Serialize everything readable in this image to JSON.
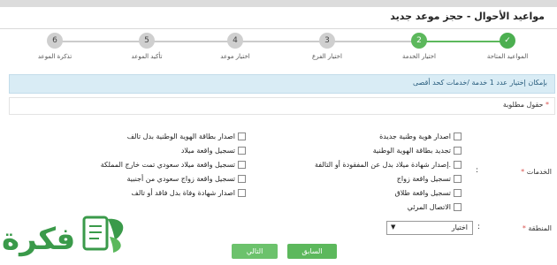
{
  "header": {
    "title": "مواعيد الأحوال - حجز موعد جديد"
  },
  "steps": [
    {
      "number": "✓",
      "label": "المواعيد المتاحة",
      "state": "done"
    },
    {
      "number": "2",
      "label": "اختيار الخدمة",
      "state": "active"
    },
    {
      "number": "3",
      "label": "اختيار الفرع",
      "state": "pending"
    },
    {
      "number": "4",
      "label": "اختيار موعد",
      "state": "pending"
    },
    {
      "number": "5",
      "label": "تأكيد الموعد",
      "state": "pending"
    },
    {
      "number": "6",
      "label": "تذكرة الموعد",
      "state": "pending"
    }
  ],
  "notice": "بإمكان إختيار عدد 1 خدمة /خدمات كحد أقصى",
  "required_note": "حقول مطلوبة",
  "services": {
    "label": "الخدمات",
    "options_right": [
      "اصدار هوية وطنية جديدة",
      "تجديد بطاقة الهوية الوطنية",
      "إصدار شهادة ميلاد بدل عن المفقودة أو التالفة.",
      "تسجيل واقعة زواج",
      "تسجيل واقعة طلاق",
      "الاتصال المرئي"
    ],
    "options_left": [
      "اصدار بطاقة الهوية الوطنية بدل تالف",
      "تسجيل واقعة ميلاد",
      "تسجيل واقعة ميلاد سعودي تمت خارج المملكة",
      "تسجيل واقعة زواج سعودي من أجنبية",
      "اصدار شهادة وفاة بدل فاقد أو تالف"
    ]
  },
  "region": {
    "label": "المنطقة",
    "selected": "اختيار"
  },
  "buttons": {
    "prev": "السابق",
    "next": "التالي"
  },
  "watermark": {
    "text": "فكرة"
  },
  "colors": {
    "accent": "#5cb85c",
    "notice_bg": "#d9ecf5",
    "logo": "#3a9a4a"
  }
}
